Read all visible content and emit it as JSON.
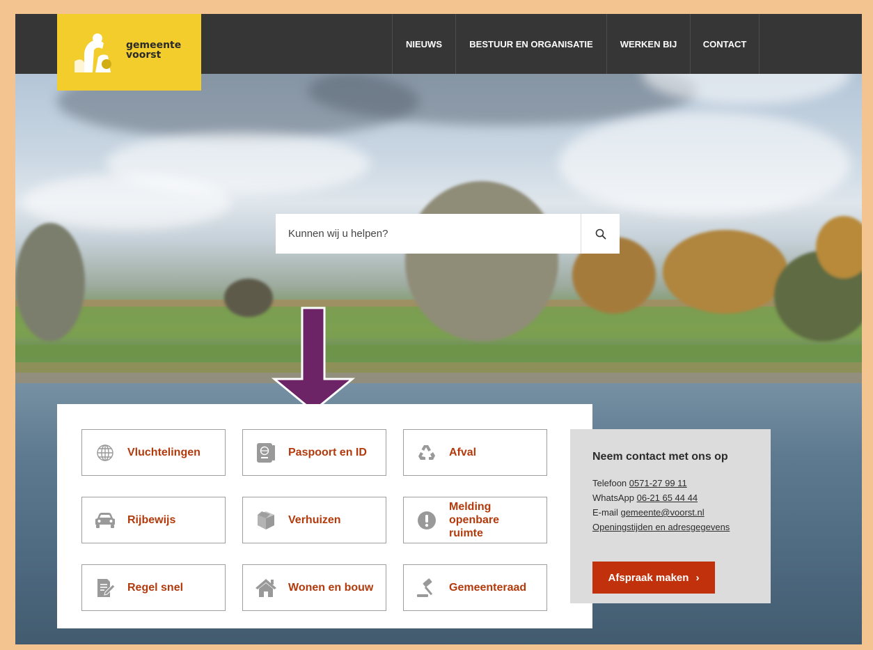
{
  "brand": {
    "line1": "gemeente",
    "line2": "voorst"
  },
  "nav": [
    "NIEUWS",
    "BESTUUR EN ORGANISATIE",
    "WERKEN BIJ",
    "CONTACT"
  ],
  "search": {
    "placeholder": "Kunnen wij u helpen?",
    "icon": "search-icon"
  },
  "tiles": [
    {
      "label": "Vluchtelingen",
      "icon": "globe-icon"
    },
    {
      "label": "Paspoort en ID",
      "icon": "passport-icon"
    },
    {
      "label": "Afval",
      "icon": "recycle-icon"
    },
    {
      "label": "Rijbewijs",
      "icon": "car-icon"
    },
    {
      "label": "Verhuizen",
      "icon": "box-icon"
    },
    {
      "label": "Melding openbare ruimte",
      "icon": "alert-icon"
    },
    {
      "label": "Regel snel",
      "icon": "document-edit-icon"
    },
    {
      "label": "Wonen en bouw",
      "icon": "house-icon"
    },
    {
      "label": "Gemeenteraad",
      "icon": "gavel-icon"
    }
  ],
  "contact": {
    "title": "Neem contact met ons op",
    "phone_label": "Telefoon",
    "phone": "0571-27 99 11",
    "whatsapp_label": "WhatsApp",
    "whatsapp": "06-21 65 44 44",
    "email_label": "E-mail",
    "email": "gemeente@voorst.nl",
    "hours_link": "Openingstijden en adresgegevens",
    "cta": "Afspraak maken",
    "cta_chevron": "›"
  },
  "colors": {
    "accent": "#b23a0c",
    "button": "#c1310c",
    "topbar": "#363636",
    "logo": "#f2cd2b",
    "annotation_arrow": "#6c2466",
    "frame": "#f3c48f"
  }
}
